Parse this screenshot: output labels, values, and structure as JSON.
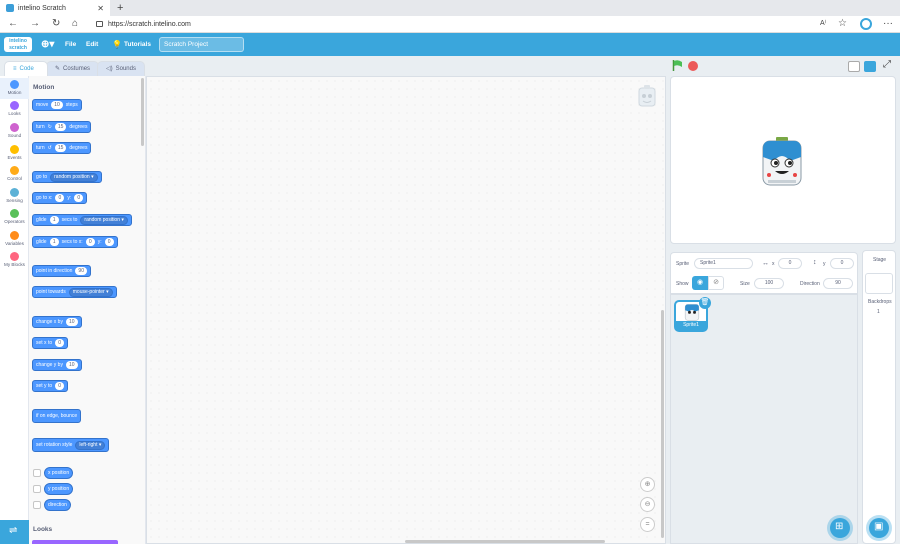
{
  "browser": {
    "tab_title": "intelino Scratch",
    "url": "https://scratch.intelino.com",
    "icons": [
      "back-icon",
      "forward-icon",
      "refresh-icon",
      "home-icon",
      "lock-icon",
      "read-aloud-icon",
      "favorites-icon",
      "profile-icon",
      "more-icon"
    ]
  },
  "menubar": {
    "logo_text": "intelino",
    "file": "File",
    "edit": "Edit",
    "tutorials": "Tutorials",
    "project_title": "Scratch Project"
  },
  "tabs": {
    "code": "Code",
    "costumes": "Costumes",
    "sounds": "Sounds"
  },
  "categories": [
    {
      "label": "Motion",
      "color": "#4c97ff"
    },
    {
      "label": "Looks",
      "color": "#9966ff"
    },
    {
      "label": "Sound",
      "color": "#cf63cf"
    },
    {
      "label": "Events",
      "color": "#ffbf00"
    },
    {
      "label": "Control",
      "color": "#ffab19"
    },
    {
      "label": "Sensing",
      "color": "#5cb1d6"
    },
    {
      "label": "Operators",
      "color": "#59c059"
    },
    {
      "label": "Variables",
      "color": "#ff8c1a"
    },
    {
      "label": "My Blocks",
      "color": "#ff6680"
    }
  ],
  "palette": {
    "motion_title": "Motion",
    "looks_title": "Looks",
    "move": {
      "a": "move",
      "v": "10",
      "b": "steps"
    },
    "turn_right": {
      "a": "turn",
      "v": "15",
      "b": "degrees"
    },
    "turn_left": {
      "a": "turn",
      "v": "15",
      "b": "degrees"
    },
    "goto": {
      "a": "go to",
      "dd": "random position"
    },
    "gotoxy": {
      "a": "go to x:",
      "x": "0",
      "b": "y:",
      "y": "0"
    },
    "glide_to": {
      "a": "glide",
      "v": "1",
      "b": "secs to",
      "dd": "random position"
    },
    "glide_xy": {
      "a": "glide",
      "v": "1",
      "b": "secs to x:",
      "x": "0",
      "c": "y:",
      "y": "0"
    },
    "point_dir": {
      "a": "point in direction",
      "v": "90"
    },
    "point_towards": {
      "a": "point towards",
      "dd": "mouse-pointer"
    },
    "change_x": {
      "a": "change x by",
      "v": "10"
    },
    "set_x": {
      "a": "set x to",
      "v": "0"
    },
    "change_y": {
      "a": "change y by",
      "v": "10"
    },
    "set_y": {
      "a": "set y to",
      "v": "0"
    },
    "bounce": {
      "a": "if on edge, bounce"
    },
    "rotation": {
      "a": "set rotation style",
      "dd": "left-right"
    },
    "xpos": "x position",
    "ypos": "y position",
    "direction": "direction"
  },
  "sprite_info": {
    "sprite_label": "Sprite",
    "sprite_name": "Sprite1",
    "x_label": "x",
    "x": "0",
    "y_label": "y",
    "y": "0",
    "show_label": "Show",
    "size_label": "Size",
    "size": "100",
    "direction_label": "Direction",
    "direction": "90"
  },
  "sprite_list": [
    {
      "name": "Sprite1"
    }
  ],
  "stage_pane": {
    "title": "Stage",
    "backdrops_label": "Backdrops",
    "backdrops_count": "1"
  },
  "colors": {
    "accent": "#3aa6dc",
    "motion": "#4c97ff",
    "green_flag": "#4cbf56",
    "stop": "#ec5959"
  }
}
